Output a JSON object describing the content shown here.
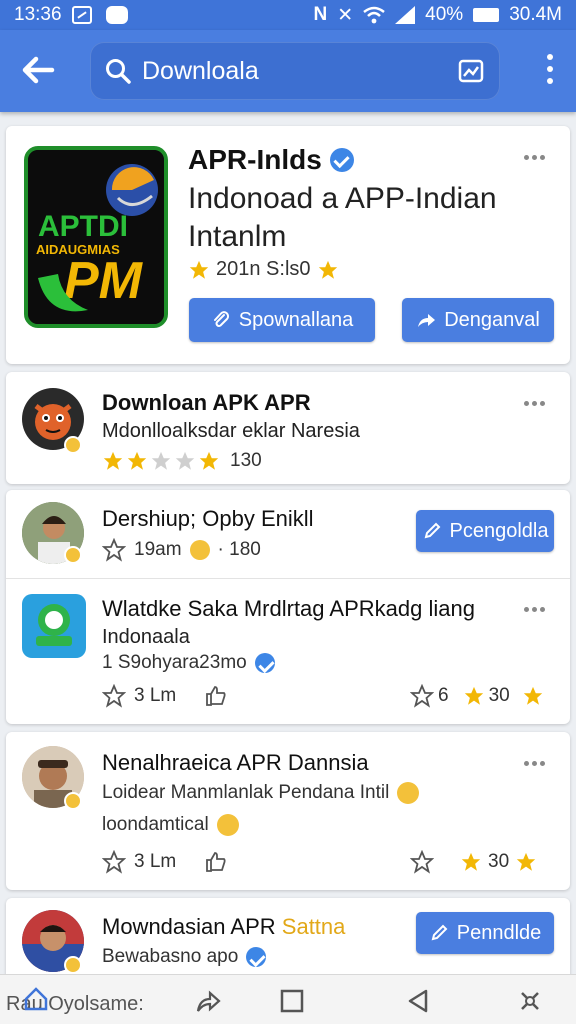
{
  "status_bar": {
    "time": "13:36",
    "battery": "40%",
    "clock_right": "30.4M"
  },
  "search": {
    "query": "Downloala"
  },
  "featured": {
    "title": "APR-Inlds",
    "subtitle_line1": "Indonoad a APP-Indian",
    "subtitle_line2": "Intanlm",
    "meta": "201n S:ls0",
    "logo_text_top": "APTDI",
    "logo_text_mid": "AIDAUGMIAS",
    "logo_text_big": "PM",
    "button_download": "Spownallana",
    "button_share": "Denganval"
  },
  "items": [
    {
      "title": "Downloan APK APR",
      "line": "Mdonlloalksdar eklar Naresia",
      "rating_text": "130"
    },
    {
      "title": "Dershiup; Opby Enikll",
      "meta_time": "19am",
      "meta_count": "· 180",
      "button": "Pcengoldla"
    },
    {
      "title": "Wlatdke Saka Mrdlrtag APRkadg liang",
      "line2": "Indonaala",
      "line3": "1 S9ohyara23mo",
      "likes": "3 Lm",
      "stat1": "6",
      "stat2": "30"
    },
    {
      "title": "Nenalhraeica APR Dannsia",
      "line": "Loidear Manmlanlak Pendana Intil",
      "line3": "loondamtical",
      "likes": "3 Lm",
      "stat": "30"
    },
    {
      "title": "Mowndasian APR",
      "title_highlight": "Sattna",
      "line": "Bewabasno apo",
      "button": "Penndlde"
    }
  ],
  "bottom_nav": {
    "label": "Rau Oyolsame:"
  },
  "colors": {
    "primary": "#4a7ee0",
    "star": "#f2b705",
    "green": "#1f8e2a"
  }
}
